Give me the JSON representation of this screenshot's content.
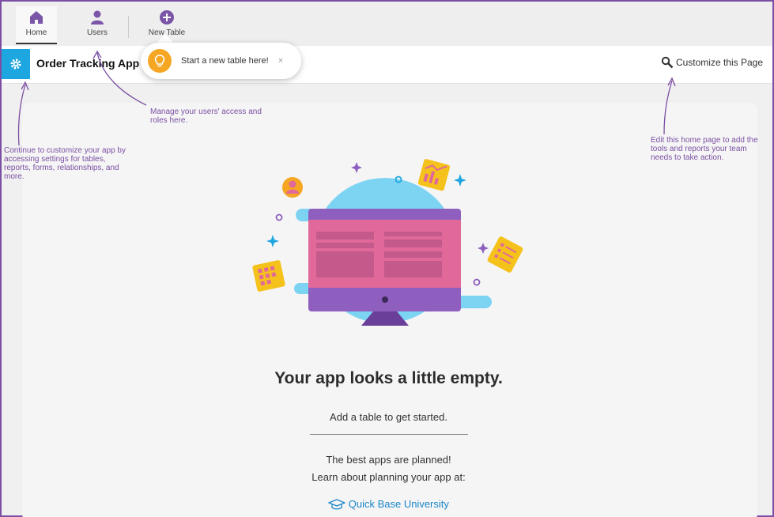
{
  "nav": {
    "home_label": "Home",
    "users_label": "Users",
    "new_table_label": "New Table"
  },
  "appbar": {
    "title": "Order Tracking App",
    "customize_label": "Customize this Page"
  },
  "tooltip": {
    "text": "Start a new table here!",
    "close": "×"
  },
  "annotations": {
    "users": "Manage your users' access and roles here.",
    "settings": "Continue to customize your app by accessing settings for tables, reports, forms, relationships, and more.",
    "customize": "Edit this home page to add the tools and reports your team needs to take action."
  },
  "main": {
    "headline": "Your app looks a little empty.",
    "subline": "Add a table to get started.",
    "plan_line1": "The best apps are planned!",
    "plan_line2": "Learn about planning your app at:",
    "link_label": "Quick Base University"
  },
  "colors": {
    "annotation": "#7b4fa3",
    "accent_blue": "#1ea6e0",
    "link": "#1b86c9",
    "nav_icon": "#7a55a8"
  }
}
